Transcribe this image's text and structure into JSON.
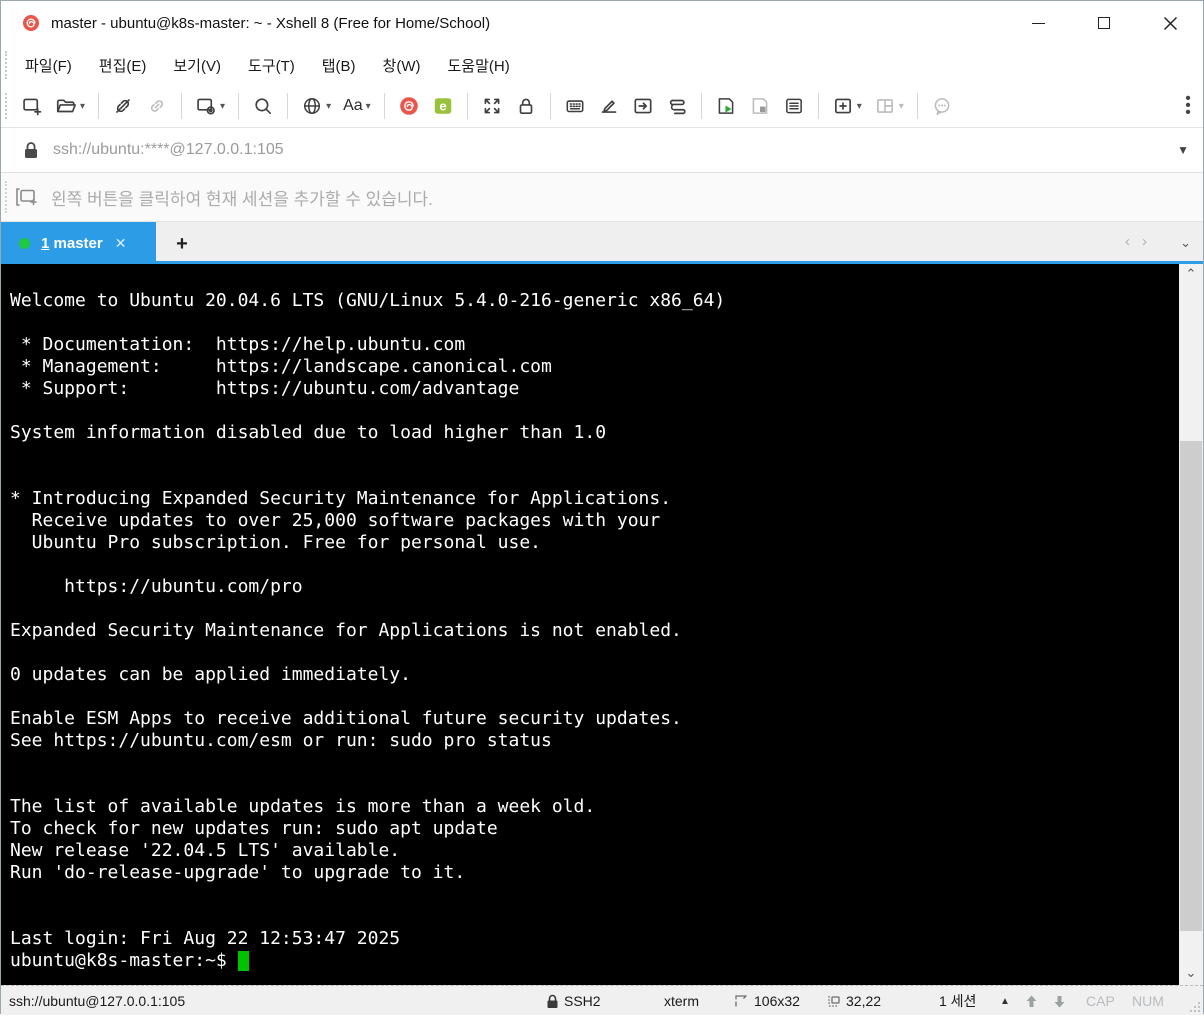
{
  "window": {
    "title": "master - ubuntu@k8s-master: ~ - Xshell 8 (Free for Home/School)"
  },
  "menu_bar": {
    "items": [
      {
        "label": "파일(F)"
      },
      {
        "label": "편집(E)"
      },
      {
        "label": "보기(V)"
      },
      {
        "label": "도구(T)"
      },
      {
        "label": "탭(B)"
      },
      {
        "label": "창(W)"
      },
      {
        "label": "도움말(H)"
      }
    ]
  },
  "toolbar": {
    "font_button_label": "Aa",
    "xftp_letter": "e"
  },
  "address_bar": {
    "value": "ssh://ubuntu:****@127.0.0.1:105"
  },
  "info_bar": {
    "message": "왼쪽 버튼을 클릭하여 현재 세션을 추가할 수 있습니다."
  },
  "tab_bar": {
    "active_tab": {
      "number": "1",
      "label": "master",
      "close_glyph": "✕"
    },
    "new_tab_label": "+"
  },
  "terminal": {
    "lines": [
      "Welcome to Ubuntu 20.04.6 LTS (GNU/Linux 5.4.0-216-generic x86_64)",
      "",
      " * Documentation:  https://help.ubuntu.com",
      " * Management:     https://landscape.canonical.com",
      " * Support:        https://ubuntu.com/advantage",
      "",
      "System information disabled due to load higher than 1.0",
      "",
      "",
      "* Introducing Expanded Security Maintenance for Applications.",
      "  Receive updates to over 25,000 software packages with your",
      "  Ubuntu Pro subscription. Free for personal use.",
      "",
      "     https://ubuntu.com/pro",
      "",
      "Expanded Security Maintenance for Applications is not enabled.",
      "",
      "0 updates can be applied immediately.",
      "",
      "Enable ESM Apps to receive additional future security updates.",
      "See https://ubuntu.com/esm or run: sudo pro status",
      "",
      "",
      "The list of available updates is more than a week old.",
      "To check for new updates run: sudo apt update",
      "New release '22.04.5 LTS' available.",
      "Run 'do-release-upgrade' to upgrade to it.",
      "",
      "",
      "Last login: Fri Aug 22 12:53:47 2025",
      "ubuntu@k8s-master:~$ "
    ]
  },
  "status_bar": {
    "session_url": "ssh://ubuntu@127.0.0.1:105",
    "protocol": "SSH2",
    "terminal_type": "xterm",
    "terminal_size": "106x32",
    "cursor_position": "32,22",
    "session_count": "1 세션",
    "caps_indicator": "CAP",
    "num_indicator": "NUM"
  },
  "colors": {
    "active_tab_blue": "#2D9CE6",
    "terminal_background": "#000000",
    "terminal_text": "#FFFFFF",
    "cursor_green": "#00C300",
    "connected_dot_green": "#1FC742",
    "xshell_red": "#E8564C",
    "xftp_green": "#99C23C"
  }
}
